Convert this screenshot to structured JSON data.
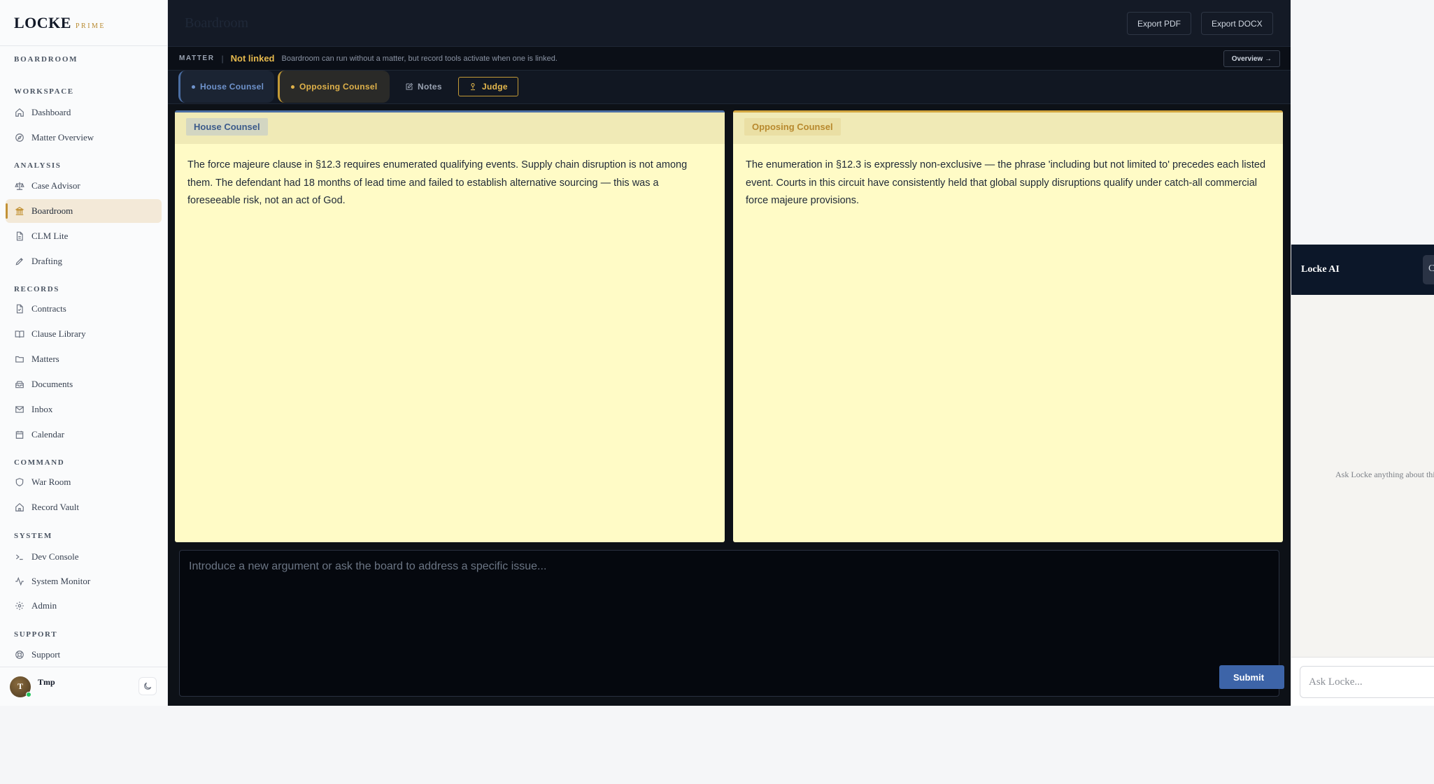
{
  "brand": {
    "name": "LOCKE",
    "tier": "PRIME"
  },
  "sidebar": {
    "context": "BOARDROOM",
    "sections": [
      {
        "label": "WORKSPACE",
        "items": [
          {
            "label": "Dashboard",
            "icon": "home-icon"
          },
          {
            "label": "Matter Overview",
            "icon": "compass-icon"
          }
        ]
      },
      {
        "label": "ANALYSIS",
        "items": [
          {
            "label": "Case Advisor",
            "icon": "scales-icon"
          },
          {
            "label": "Boardroom",
            "icon": "columns-icon",
            "active": true
          },
          {
            "label": "CLM Lite",
            "icon": "file-icon"
          },
          {
            "label": "Drafting",
            "icon": "pen-icon"
          }
        ]
      },
      {
        "label": "RECORDS",
        "items": [
          {
            "label": "Contracts",
            "icon": "file-check-icon"
          },
          {
            "label": "Clause Library",
            "icon": "book-icon"
          },
          {
            "label": "Matters",
            "icon": "folder-icon"
          },
          {
            "label": "Documents",
            "icon": "archive-icon"
          },
          {
            "label": "Inbox",
            "icon": "mail-icon"
          },
          {
            "label": "Calendar",
            "icon": "calendar-icon"
          }
        ]
      },
      {
        "label": "COMMAND",
        "items": [
          {
            "label": "War Room",
            "icon": "shield-icon"
          },
          {
            "label": "Record Vault",
            "icon": "vault-icon"
          }
        ]
      },
      {
        "label": "SYSTEM",
        "items": [
          {
            "label": "Dev Console",
            "icon": "terminal-icon"
          },
          {
            "label": "System Monitor",
            "icon": "activity-icon"
          },
          {
            "label": "Admin",
            "icon": "gear-icon"
          }
        ]
      },
      {
        "label": "SUPPORT",
        "items": [
          {
            "label": "Support",
            "icon": "lifebuoy-icon"
          }
        ]
      }
    ],
    "user": {
      "initial": "T",
      "name": "Tmp"
    }
  },
  "header": {
    "title": "Boardroom",
    "export_pdf": "Export PDF",
    "export_docx": "Export DOCX"
  },
  "matter": {
    "label": "MATTER",
    "separator": "|",
    "status": "Not linked",
    "description": "Boardroom can run without a matter, but record tools activate when one is linked.",
    "overview_button": "Overview →"
  },
  "tabs": {
    "house": "House Counsel",
    "opposing": "Opposing Counsel",
    "notes": "Notes",
    "judge": "Judge"
  },
  "panels": {
    "house": {
      "title": "House Counsel",
      "body": "The force majeure clause in §12.3 requires enumerated qualifying events. Supply chain disruption is not among them. The defendant had 18 months of lead time and failed to establish alternative sourcing — this was a foreseeable risk, not an act of God."
    },
    "opposing": {
      "title": "Opposing Counsel",
      "body": "The enumeration in §12.3 is expressly non-exclusive — the phrase 'including but not limited to' precedes each listed event. Courts in this circuit have consistently held that global supply disruptions qualify under catch-all commercial force majeure provisions."
    }
  },
  "composer": {
    "placeholder": "Introduce a new argument or ask the board to address a specific issue...",
    "submit_label": "Submit"
  },
  "ai": {
    "title": "Locke AI",
    "header_button": "C",
    "empty_text": "Ask Locke anything about this matter",
    "input_placeholder": "Ask Locke..."
  },
  "colors": {
    "accent_gold": "#c39a36",
    "house_blue": "#4b6ea3",
    "panel_yellow": "#fffbc6",
    "dark_bg": "#0d1117"
  }
}
